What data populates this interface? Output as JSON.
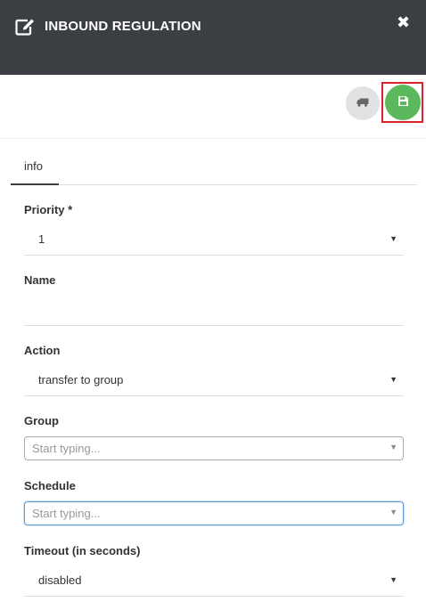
{
  "header": {
    "title": "INBOUND REGULATION",
    "close_glyph": "✖",
    "icon": "edit-icon",
    "background": "#3b3f44"
  },
  "toolbar": {
    "secondary_icon": "truck-icon",
    "save_icon": "save-icon",
    "save_color": "#5cb85c",
    "highlight_color": "#d9232d"
  },
  "tabs": [
    {
      "label": "info",
      "active": true
    }
  ],
  "form": {
    "priority": {
      "label": "Priority *",
      "value": "1"
    },
    "name": {
      "label": "Name",
      "value": ""
    },
    "action": {
      "label": "Action",
      "value": "transfer to group"
    },
    "group": {
      "label": "Group",
      "placeholder": "Start typing..."
    },
    "schedule": {
      "label": "Schedule",
      "placeholder": "Start typing..."
    },
    "timeout": {
      "label": "Timeout (in seconds)",
      "value": "disabled"
    }
  },
  "caret_glyph": "▼"
}
